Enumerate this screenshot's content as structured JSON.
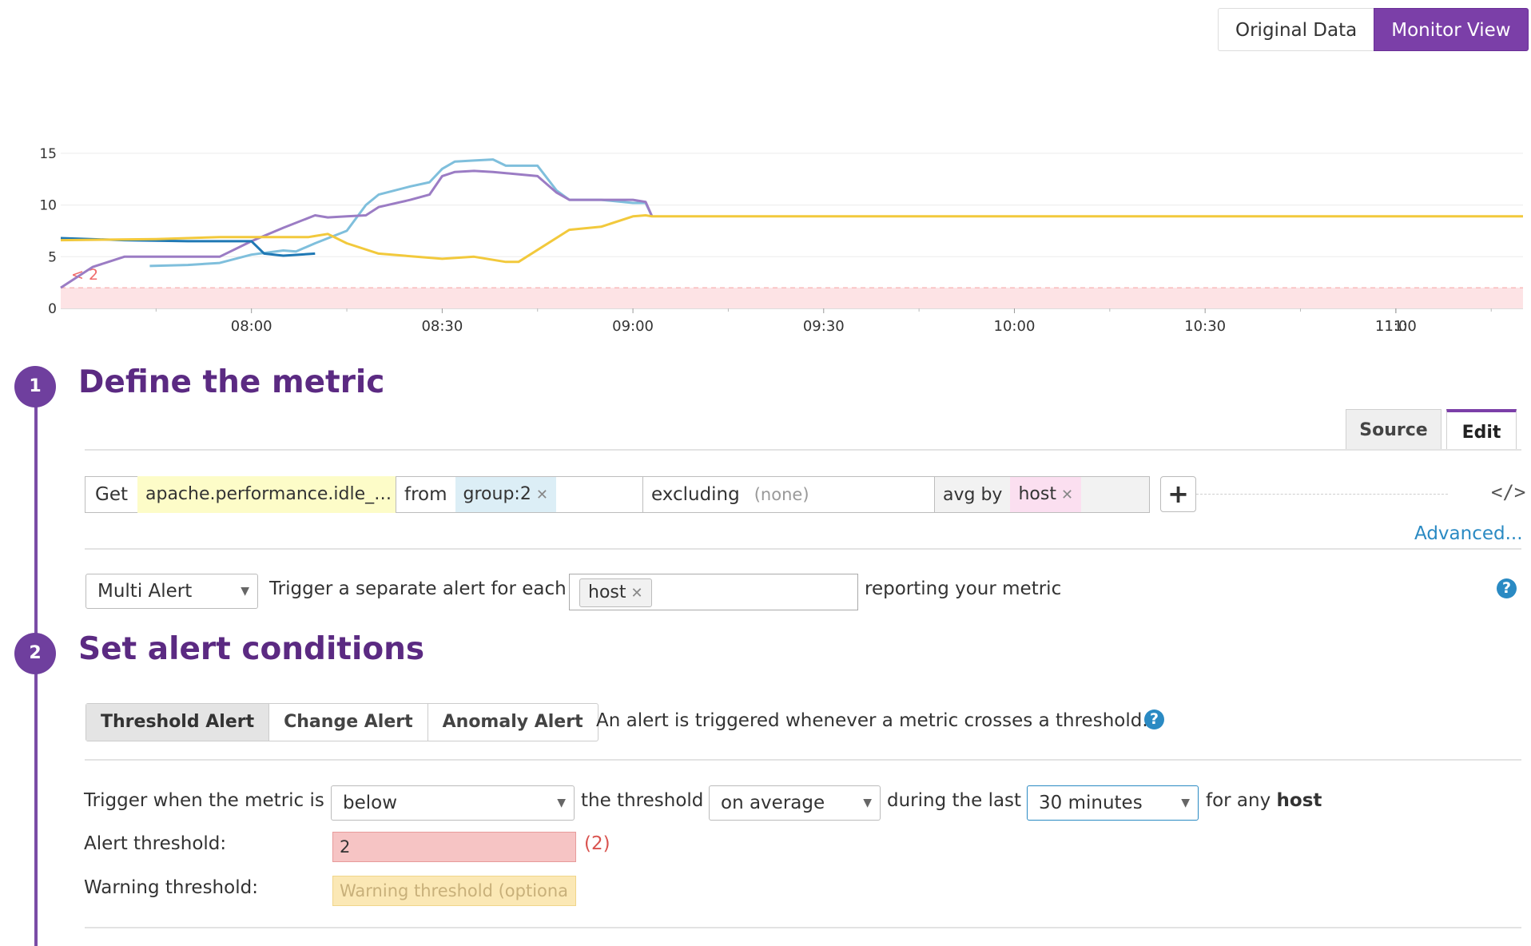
{
  "view_toggle": {
    "original": "Original Data",
    "monitor": "Monitor View"
  },
  "chart_data": {
    "type": "line",
    "x_ticks": [
      "08:00",
      "08:30",
      "09:00",
      "09:30",
      "10:00",
      "10:30",
      "11:00",
      "11:"
    ],
    "y_ticks": [
      "0",
      "5",
      "10",
      "15"
    ],
    "ylim": [
      0,
      15
    ],
    "threshold": {
      "value": 2,
      "label": "< 2",
      "color": "#f06a6a"
    },
    "series": [
      {
        "color": "#7fbfdc",
        "x": [
          "07:44",
          "07:50",
          "07:55",
          "08:00",
          "08:05",
          "08:07",
          "08:10",
          "08:15",
          "08:18",
          "08:20",
          "08:25",
          "08:28",
          "08:30",
          "08:32",
          "08:35",
          "08:38",
          "08:40",
          "08:45",
          "08:48",
          "08:50",
          "08:52",
          "08:55",
          "09:00",
          "09:02",
          "09:03"
        ],
        "y": [
          4.1,
          4.2,
          4.4,
          5.2,
          5.6,
          5.5,
          6.3,
          7.5,
          10.0,
          11.0,
          11.8,
          12.2,
          13.5,
          14.2,
          14.3,
          14.4,
          13.8,
          13.8,
          11.4,
          10.5,
          10.5,
          10.5,
          10.2,
          10.2,
          8.9
        ]
      },
      {
        "color": "#9b7cc4",
        "x": [
          "07:30",
          "07:35",
          "07:40",
          "07:45",
          "07:50",
          "07:55",
          "08:00",
          "08:05",
          "08:10",
          "08:12",
          "08:15",
          "08:18",
          "08:20",
          "08:25",
          "08:28",
          "08:30",
          "08:32",
          "08:35",
          "08:38",
          "08:45",
          "08:48",
          "08:50",
          "08:55",
          "09:00",
          "09:02",
          "09:03"
        ],
        "y": [
          2.0,
          4.0,
          5.0,
          5.0,
          5.0,
          5.0,
          6.5,
          7.8,
          9.0,
          8.8,
          8.9,
          9.0,
          9.8,
          10.5,
          11.0,
          12.8,
          13.2,
          13.3,
          13.2,
          12.8,
          11.2,
          10.5,
          10.5,
          10.5,
          10.3,
          8.9
        ]
      },
      {
        "color": "#1f78b4",
        "x": [
          "07:30",
          "07:40",
          "07:50",
          "07:55",
          "08:00",
          "08:02",
          "08:05",
          "08:10"
        ],
        "y": [
          6.8,
          6.6,
          6.5,
          6.5,
          6.5,
          5.3,
          5.1,
          5.3
        ]
      },
      {
        "color": "#f2c93c",
        "x": [
          "07:30",
          "07:45",
          "07:55",
          "08:00",
          "08:05",
          "08:09",
          "08:10",
          "08:12",
          "08:15",
          "08:20",
          "08:30",
          "08:35",
          "08:40",
          "08:42",
          "08:50",
          "08:55",
          "09:00",
          "09:02",
          "09:03",
          "11:20"
        ],
        "y": [
          6.6,
          6.7,
          6.9,
          6.9,
          6.9,
          6.9,
          7.0,
          7.2,
          6.3,
          5.3,
          4.8,
          5.0,
          4.5,
          4.5,
          7.6,
          7.9,
          8.9,
          9.0,
          8.9,
          8.9
        ]
      }
    ]
  },
  "step1": {
    "number": "1",
    "title": "Define the metric"
  },
  "tabs": {
    "source": "Source",
    "edit": "Edit"
  },
  "query": {
    "get_label": "Get",
    "metric": "apache.performance.idle_…",
    "from_label": "from",
    "from_tag": "group:2",
    "excluding_label": "excluding",
    "excluding_value": "(none)",
    "avg_by_label": "avg by",
    "avg_by_tag": "host",
    "add_symbol": "+",
    "code_symbol": "</>",
    "advanced": "Advanced..."
  },
  "multi": {
    "select": "Multi Alert",
    "text_before": "Trigger a separate alert for each",
    "tag": "host",
    "text_after": "reporting your metric",
    "help": "?"
  },
  "step2": {
    "number": "2",
    "title": "Set alert conditions"
  },
  "alert_types": {
    "threshold": "Threshold Alert",
    "change": "Change Alert",
    "anomaly": "Anomaly Alert",
    "description": "An alert is triggered whenever a metric crosses a threshold.",
    "help": "?"
  },
  "conditions": {
    "trigger_label": "Trigger when the metric is",
    "comparison": "below",
    "threshold_label": "the threshold",
    "aggregation": "on average",
    "during_label": "during the last",
    "window": "30 minutes",
    "for_any": "for any",
    "for_any_tag": "host",
    "alert_label": "Alert threshold:",
    "alert_value": "2",
    "alert_note": "(2)",
    "warning_label": "Warning threshold:",
    "warning_placeholder": "Warning threshold (optiona"
  }
}
